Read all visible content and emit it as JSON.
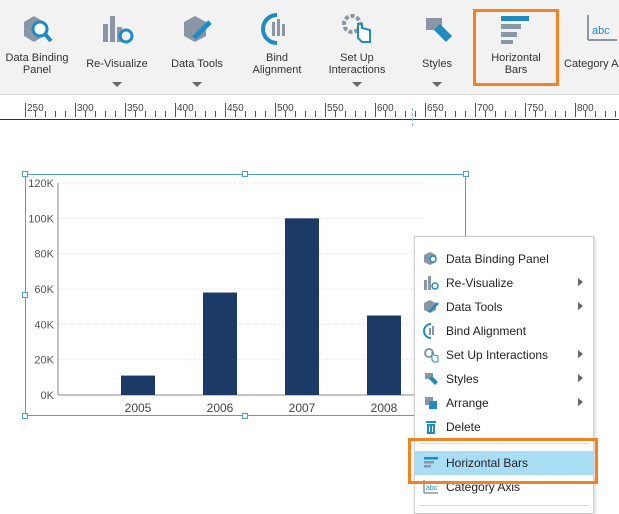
{
  "ribbon": {
    "buttons": [
      {
        "label": "Data Binding\nPanel",
        "icon": "data-binding-panel-icon"
      },
      {
        "label": "Re-Visualize",
        "icon": "re-visualize-icon"
      },
      {
        "label": "Data Tools",
        "icon": "data-tools-icon"
      },
      {
        "label": "Bind\nAlignment",
        "icon": "bind-alignment-icon"
      },
      {
        "label": "Set Up\nInteractions",
        "icon": "set-up-interactions-icon"
      },
      {
        "label": "Styles",
        "icon": "styles-icon"
      },
      {
        "label": "Horizontal\nBars",
        "icon": "horizontal-bars-icon"
      },
      {
        "label": "Category Axis",
        "icon": "category-axis-icon"
      }
    ]
  },
  "ruler": {
    "ticks": [
      "250",
      "300",
      "350",
      "400",
      "450",
      "500",
      "550",
      "600",
      "650",
      "700",
      "750",
      "800"
    ]
  },
  "chart_data": {
    "type": "bar",
    "categories": [
      "2005",
      "2006",
      "2007",
      "2008"
    ],
    "values": [
      11000,
      58000,
      100000,
      45000
    ],
    "ylim": [
      0,
      120000
    ],
    "yticks": [
      "0K",
      "20K",
      "40K",
      "60K",
      "80K",
      "100K",
      "120K"
    ],
    "grid": true,
    "color": "#1c3a66"
  },
  "context_menu": {
    "items": [
      {
        "label": "Data Binding Panel",
        "submenu": false
      },
      {
        "label": "Re-Visualize",
        "submenu": true
      },
      {
        "label": "Data Tools",
        "submenu": true
      },
      {
        "label": "Bind Alignment",
        "submenu": false
      },
      {
        "label": "Set Up Interactions",
        "submenu": true
      },
      {
        "label": "Styles",
        "submenu": true
      },
      {
        "label": "Arrange",
        "submenu": true
      },
      {
        "label": "Delete",
        "submenu": false
      },
      {
        "label": "Horizontal Bars",
        "submenu": false
      },
      {
        "label": "Category Axis",
        "submenu": false
      }
    ]
  },
  "colors": {
    "accent": "#f58220",
    "selection": "#4a9fd0",
    "menu_active": "#a9ddf6"
  }
}
